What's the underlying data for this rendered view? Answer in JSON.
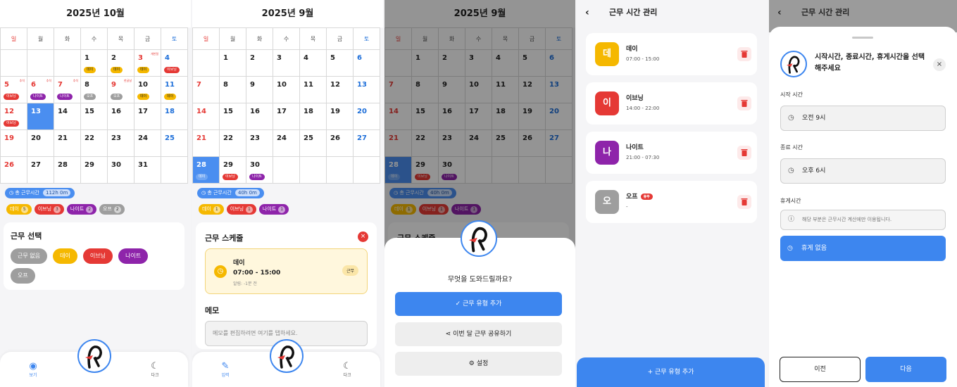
{
  "cal_oct": {
    "title": "2025년 10월",
    "weekdays": [
      "일",
      "월",
      "화",
      "수",
      "목",
      "금",
      "토"
    ],
    "total_label": "총 근무시간",
    "total_value": "112h 0m",
    "counts": [
      {
        "label": "데이",
        "n": "5"
      },
      {
        "label": "이브닝",
        "n": "3"
      },
      {
        "label": "나이트",
        "n": "2"
      },
      {
        "label": "오프",
        "n": "2"
      }
    ],
    "select_title": "근무 선택",
    "select_options": [
      "근무 없음",
      "데이",
      "이브닝",
      "나이트",
      "오프"
    ],
    "nav_view": "보기",
    "nav_dark": "다크"
  },
  "cal_sep": {
    "title": "2025년 9월",
    "total_label": "총 근무시간",
    "total_value": "40h 0m",
    "counts": [
      {
        "label": "데이",
        "n": "1"
      },
      {
        "label": "이브닝",
        "n": "1"
      },
      {
        "label": "나이트",
        "n": "1"
      }
    ],
    "schedule_title": "근무 스케줄",
    "schedule_name": "데이",
    "schedule_time": "07:00 - 15:00",
    "schedule_alarm": "알림: -1분 전",
    "schedule_tag": "근무",
    "memo_title": "메모",
    "memo_placeholder": "메모를 편집하려면 여기를 탭하세요.",
    "nav_input": "입력",
    "nav_dark": "다크"
  },
  "assist": {
    "title": "2025년 9월",
    "question": "무엇을 도와드릴까요?",
    "add_label": "근무 유형 추가",
    "share_label": "이번 달 근무 공유하기",
    "settings_label": "설정",
    "schedule_title": "근무 스케줄",
    "total_label": "총 근무시간",
    "total_value": "40h 0m",
    "counts": [
      {
        "label": "데이",
        "n": "1"
      },
      {
        "label": "이브닝",
        "n": "1"
      },
      {
        "label": "나이트",
        "n": "1"
      }
    ]
  },
  "manage": {
    "title": "근무 시간 관리",
    "types": [
      {
        "badge": "데",
        "name": "데이",
        "time": "07:00 - 15:00",
        "color": "#f5b800"
      },
      {
        "badge": "이",
        "name": "이브닝",
        "time": "14:00 - 22:00",
        "color": "#e53935"
      },
      {
        "badge": "나",
        "name": "나이트",
        "time": "21:00 - 07:30",
        "color": "#8e24aa"
      },
      {
        "badge": "오",
        "name": "오프",
        "time": "-",
        "color": "#9e9e9e"
      }
    ],
    "off_tag": "휴무",
    "add_label": "근무 유형 추가"
  },
  "time_sheet": {
    "title": "근무 시간 관리",
    "heading": "시작시간, 종료시간, 휴게시간을 선택해주세요",
    "start_label": "시작 시간",
    "start_value": "오전 9시",
    "end_label": "종료 시간",
    "end_value": "오후 6시",
    "break_label": "휴게시간",
    "break_note": "해당 부분은 근무시간 계산에만 이용됩니다.",
    "break_button": "휴게 없음",
    "prev_label": "이전",
    "next_label": "다음"
  }
}
